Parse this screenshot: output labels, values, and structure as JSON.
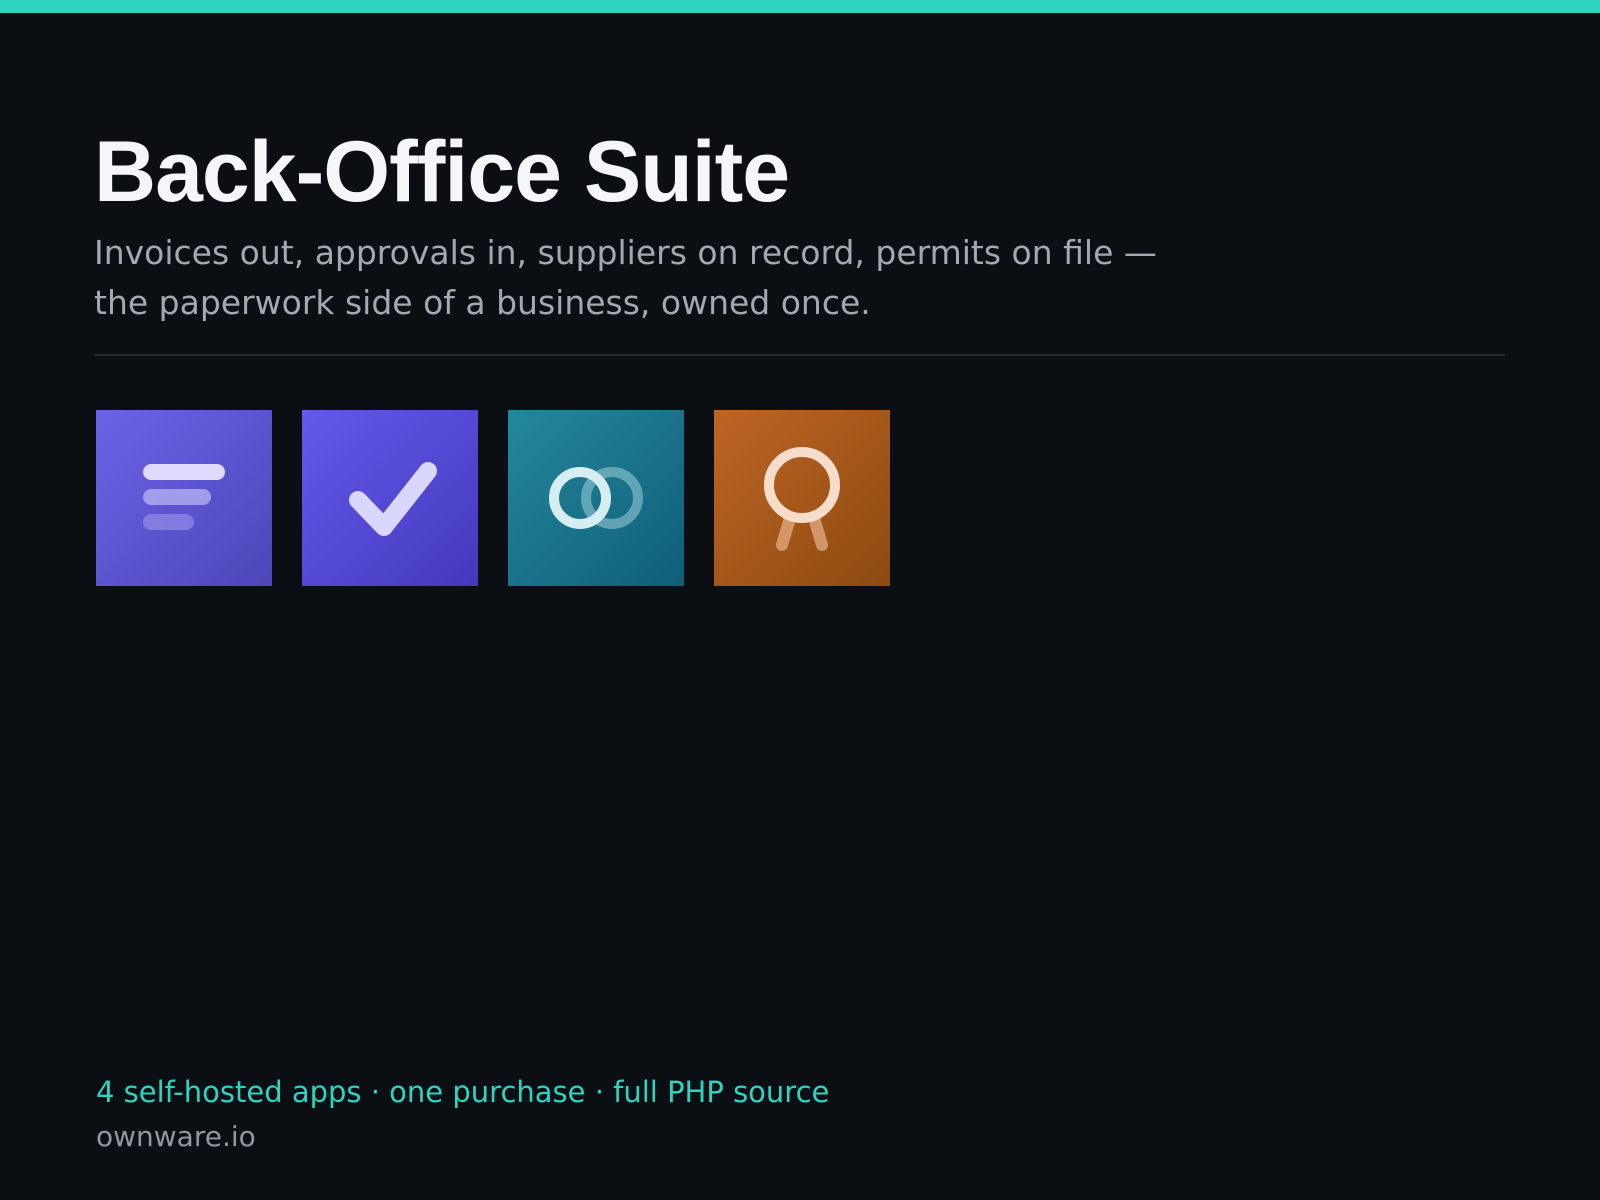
{
  "hero": {
    "title": "Back-Office Suite",
    "subtitle_line1": "Invoices out, approvals in, suppliers on record, permits on file —",
    "subtitle_line2": "the paperwork side of a business, owned once."
  },
  "apps": [
    {
      "icon": "invoice-lines-icon",
      "color_from": "#6b63e6",
      "color_to": "#4d46b8"
    },
    {
      "icon": "checkmark-icon",
      "color_from": "#6359ea",
      "color_to": "#4439bd"
    },
    {
      "icon": "linked-rings-icon",
      "color_from": "#24879c",
      "color_to": "#0f5f78"
    },
    {
      "icon": "award-badge-icon",
      "color_from": "#bf6425",
      "color_to": "#8c4a10"
    }
  ],
  "footer": {
    "tagline": "4 self-hosted apps · one purchase · full PHP source",
    "domain": "ownware.io"
  },
  "colors": {
    "background": "#0b0e13",
    "accent": "#2dd4bf",
    "title": "#f5f6f9",
    "muted": "#a2a8b4"
  }
}
